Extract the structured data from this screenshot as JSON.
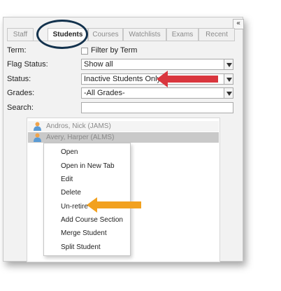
{
  "panel": {
    "collapse_glyph": "«",
    "tabs": [
      "Staff",
      "Students",
      "Courses",
      "Watchlists",
      "Exams",
      "Recent"
    ],
    "active_tab": "Students"
  },
  "filters": {
    "term_label": "Term:",
    "filter_by_term": "Filter by Term",
    "flag_status_label": "Flag Status:",
    "flag_status_value": "Show all",
    "status_label": "Status:",
    "status_value": "Inactive Students Only",
    "grades_label": "Grades:",
    "grades_value": "-All Grades-",
    "search_label": "Search:",
    "search_value": ""
  },
  "students": [
    {
      "name": "Andros, Nick (JAMS)"
    },
    {
      "name": "Avery, Harper (ALMS)"
    }
  ],
  "context_menu": [
    "Open",
    "Open in New Tab",
    "Edit",
    "Delete",
    "Un-retire",
    "Add Course Section",
    "Merge Student",
    "Split Student"
  ],
  "colors": {
    "status_arrow": "#d9363e",
    "unretire_arrow": "#f2a11f",
    "highlight_circle": "#13324d",
    "person_icon_body": "#5b9bd5",
    "person_icon_head": "#f0a34a"
  },
  "icons": {
    "student": "person-icon",
    "collapse": "collapse-icon",
    "dropdown": "chevron-down-icon"
  }
}
